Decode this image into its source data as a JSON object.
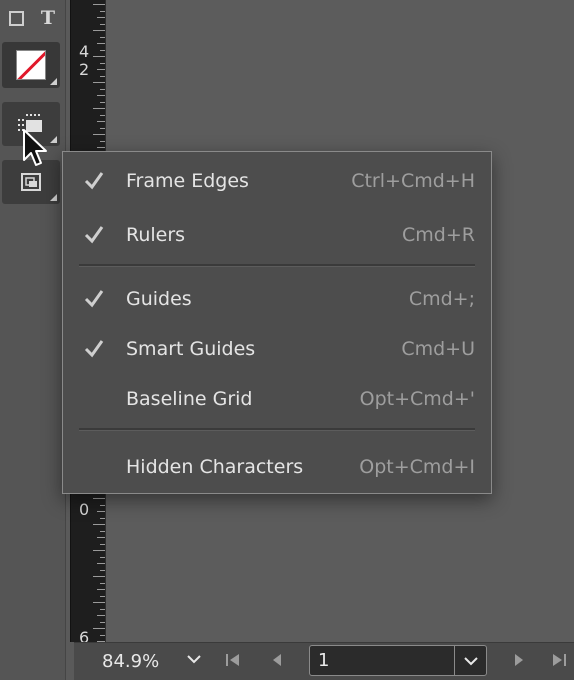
{
  "toolbar": {
    "type_tool_glyph": "T"
  },
  "ruler": {
    "numbers": [
      "4",
      "2",
      "0",
      "6"
    ]
  },
  "menu": {
    "items": [
      {
        "label": "Frame Edges",
        "shortcut": "Ctrl+Cmd+H",
        "checked": true
      },
      {
        "label": "Rulers",
        "shortcut": "Cmd+R",
        "checked": true
      },
      {
        "label": "Guides",
        "shortcut": "Cmd+;",
        "checked": true
      },
      {
        "label": "Smart Guides",
        "shortcut": "Cmd+U",
        "checked": true
      },
      {
        "label": "Baseline Grid",
        "shortcut": "Opt+Cmd+'",
        "checked": false
      },
      {
        "label": "Hidden Characters",
        "shortcut": "Opt+Cmd+I",
        "checked": false
      }
    ]
  },
  "bottombar": {
    "zoom": "84.9%",
    "page": "1"
  },
  "colors": {
    "stroke_none_slash": "#e0182a",
    "menu_bg": "#4d4d4d"
  },
  "icons": {
    "zoom_dropdown": "chevron-down-icon",
    "first_page": "first-page-icon",
    "prev_page": "prev-page-icon",
    "next_page": "next-page-icon",
    "last_page": "last-page-icon",
    "check": "checkmark-icon"
  }
}
